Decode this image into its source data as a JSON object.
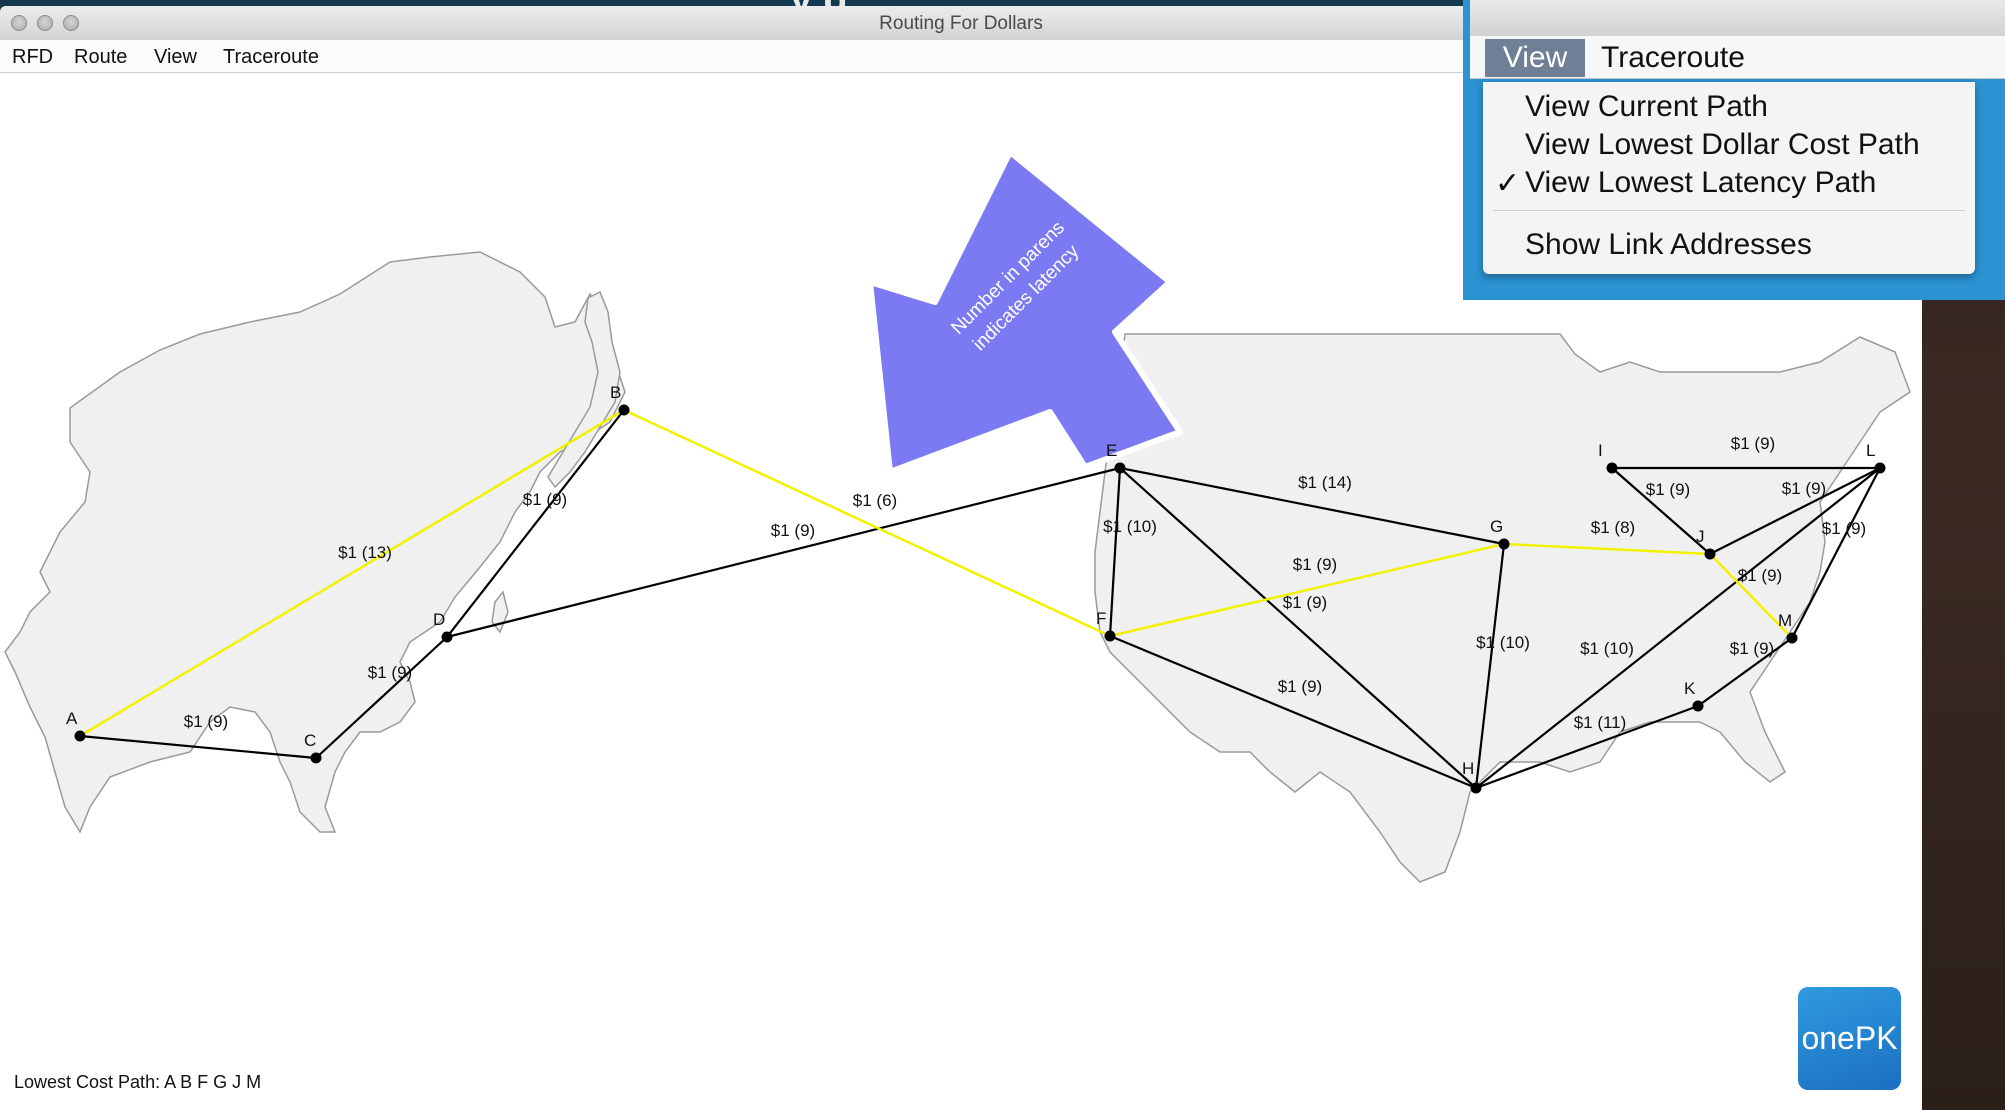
{
  "slide_title_fragment": "y  g",
  "window": {
    "title": "Routing For Dollars",
    "menu": [
      "RFD",
      "Route",
      "View",
      "Traceroute"
    ]
  },
  "dropdown": {
    "menubar_active": "View",
    "menubar_other": "Traceroute",
    "items": [
      {
        "label": "View Current Path",
        "checked": false
      },
      {
        "label": "View Lowest Dollar Cost Path",
        "checked": false
      },
      {
        "label": "View Lowest Latency Path",
        "checked": true
      },
      {
        "label": "Show Link Addresses",
        "checked": false
      }
    ],
    "check_glyph": "✓"
  },
  "callout": {
    "text_line1": "Number in parens",
    "text_line2": "indicates latency",
    "color": "#7b7af2"
  },
  "nodes": {
    "A": "A",
    "B": "B",
    "C": "C",
    "D": "D",
    "E": "E",
    "F": "F",
    "G": "G",
    "H": "H",
    "I": "I",
    "J": "J",
    "K": "K",
    "L": "L",
    "M": "M"
  },
  "links": [
    {
      "from": "A",
      "to": "B",
      "label": "$1 (13)",
      "highlighted": true
    },
    {
      "from": "A",
      "to": "C",
      "label": "$1 (9)",
      "highlighted": false
    },
    {
      "from": "C",
      "to": "D",
      "label": "$1 (9)",
      "highlighted": false
    },
    {
      "from": "D",
      "to": "B",
      "label": "$1 (9)",
      "highlighted": false
    },
    {
      "from": "D",
      "to": "E",
      "label": "$1 (9)",
      "highlighted": false
    },
    {
      "from": "B",
      "to": "F",
      "label": "$1 (6)",
      "highlighted": true
    },
    {
      "from": "E",
      "to": "F",
      "label": "$1 (10)",
      "highlighted": false
    },
    {
      "from": "E",
      "to": "G",
      "label": "$1 (14)",
      "highlighted": false
    },
    {
      "from": "E",
      "to": "H",
      "label": "$1 (9)",
      "highlighted": false
    },
    {
      "from": "F",
      "to": "G",
      "label": "$1 (9)",
      "highlighted": true
    },
    {
      "from": "F",
      "to": "H",
      "label": "$1 (9)",
      "highlighted": false
    },
    {
      "from": "G",
      "to": "H",
      "label": "$1 (10)",
      "highlighted": false
    },
    {
      "from": "G",
      "to": "J",
      "label": "$1 (8)",
      "highlighted": true
    },
    {
      "from": "H",
      "to": "L",
      "label": "$1 (10)",
      "highlighted": false
    },
    {
      "from": "H",
      "to": "K",
      "label": "$1 (11)",
      "highlighted": false
    },
    {
      "from": "I",
      "to": "L",
      "label": "$1 (9)",
      "highlighted": false
    },
    {
      "from": "I",
      "to": "J",
      "label": "$1 (9)",
      "highlighted": false
    },
    {
      "from": "J",
      "to": "L",
      "label": "$1 (9)",
      "highlighted": false
    },
    {
      "from": "L",
      "to": "M",
      "label": "$1 (9)",
      "highlighted": false
    },
    {
      "from": "J",
      "to": "M",
      "label": "$1 (9)",
      "highlighted": true
    },
    {
      "from": "K",
      "to": "M",
      "label": "$1 (9)",
      "highlighted": false
    }
  ],
  "path_color": "#f2f200",
  "link_color": "#000000",
  "status": "Lowest Cost Path: A B F G J M",
  "logo": "onePK"
}
